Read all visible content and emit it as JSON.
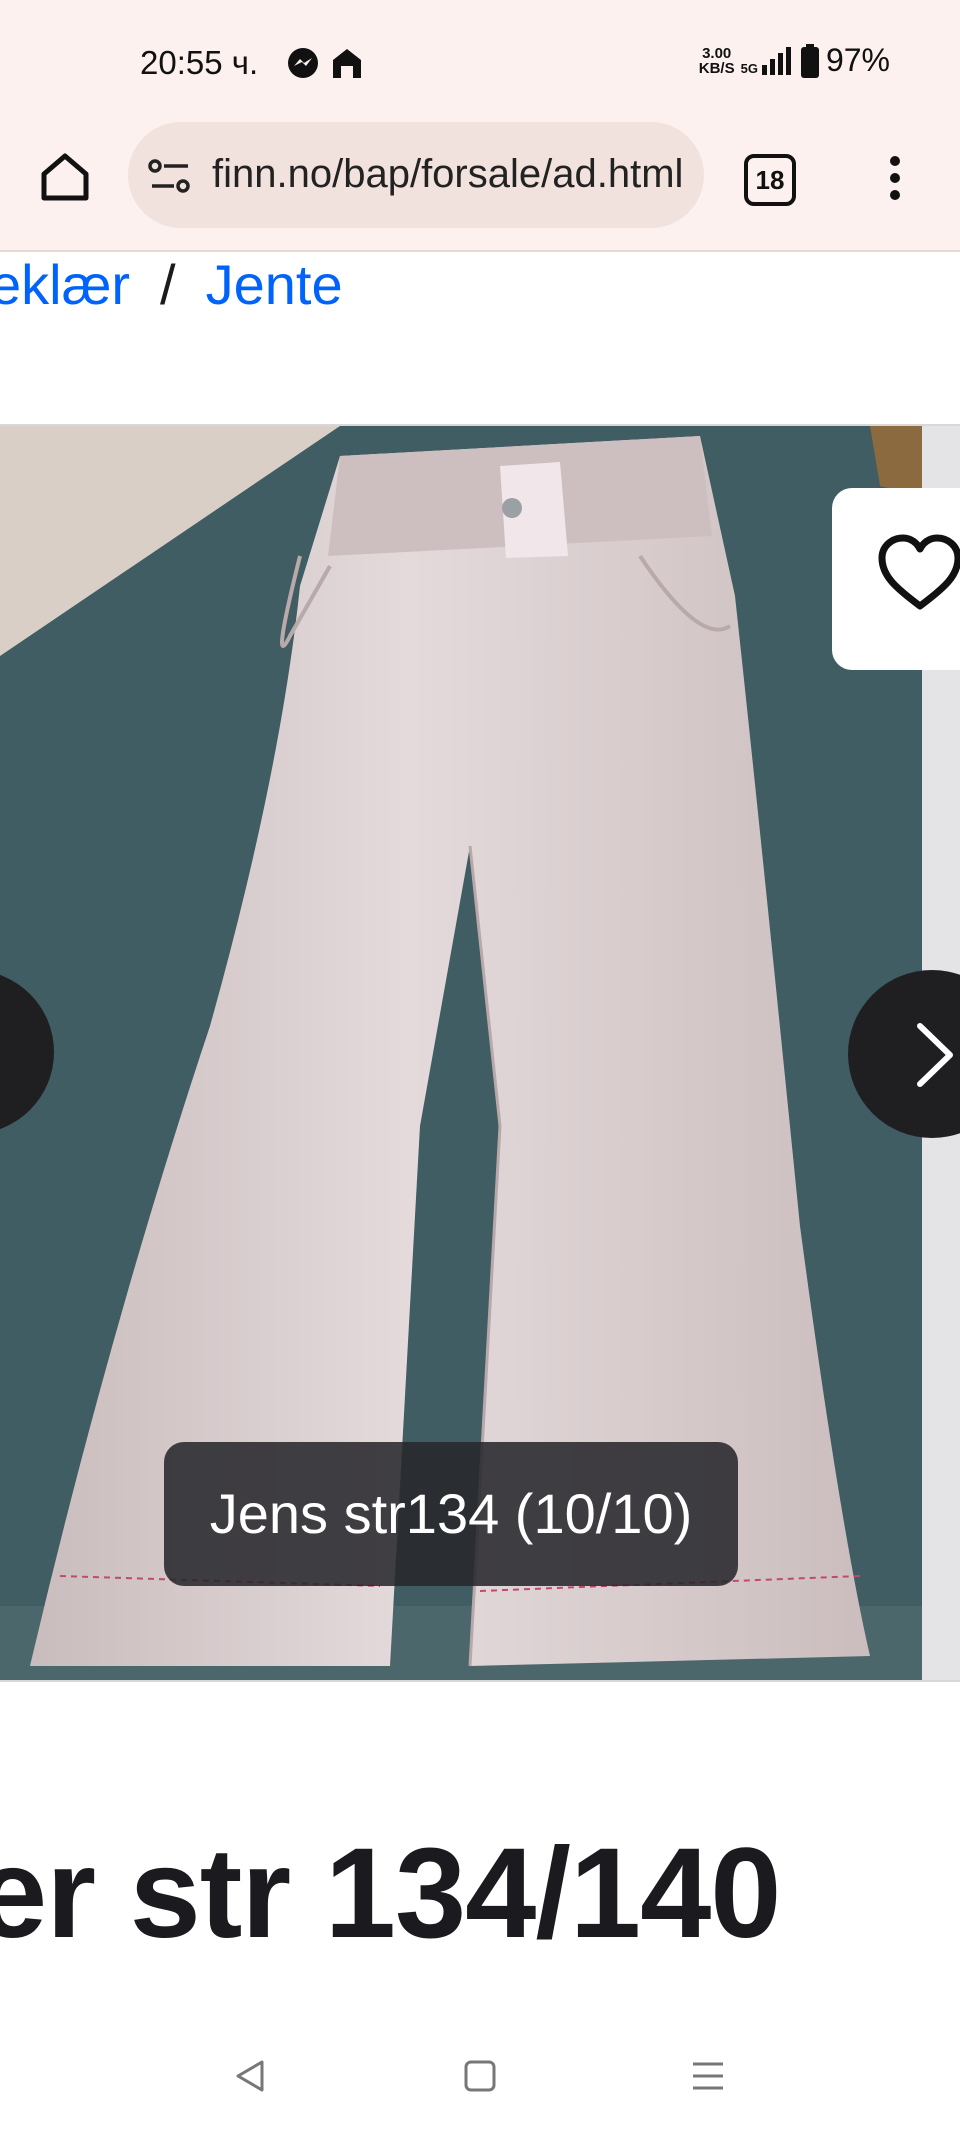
{
  "status_bar": {
    "time": "20:55 ч.",
    "speed_value": "3.00",
    "speed_unit": "KB/S",
    "network": "5G",
    "battery": "97%"
  },
  "browser": {
    "url": "finn.no/bap/forsale/ad.html",
    "tab_count": "18"
  },
  "breadcrumb": {
    "items": [
      "eklær",
      "Jente"
    ],
    "separator": "/"
  },
  "gallery": {
    "caption": "Jens str134 (10/10)"
  },
  "listing": {
    "title": "er str 134/140"
  },
  "colors": {
    "link": "#0063fb",
    "chrome_background": "#fcf1ee"
  }
}
